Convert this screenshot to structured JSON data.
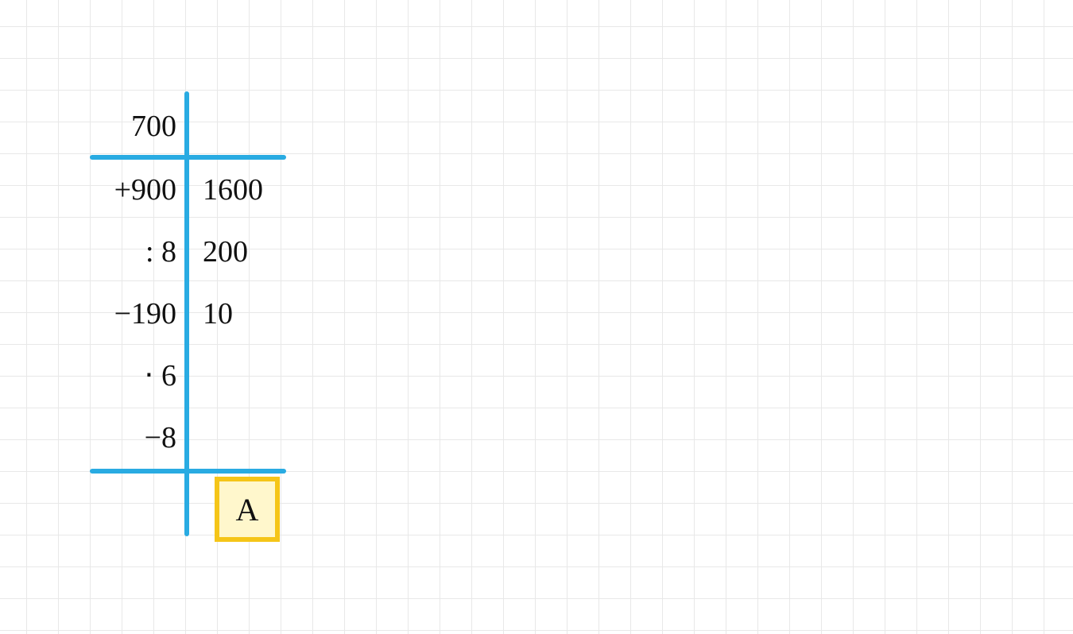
{
  "start_value": "700",
  "operations": [
    {
      "op": "+900",
      "result": "1600"
    },
    {
      "op": ": 8",
      "result": "200"
    },
    {
      "op": "−190",
      "result": "10"
    },
    {
      "op": "⋅ 6",
      "result": ""
    },
    {
      "op": "−8",
      "result": ""
    }
  ],
  "answer_label": "A",
  "colors": {
    "line": "#29abe2",
    "grid": "#e8e8e8",
    "highlight_border": "#f5c518",
    "highlight_fill": "#fff7cc"
  }
}
